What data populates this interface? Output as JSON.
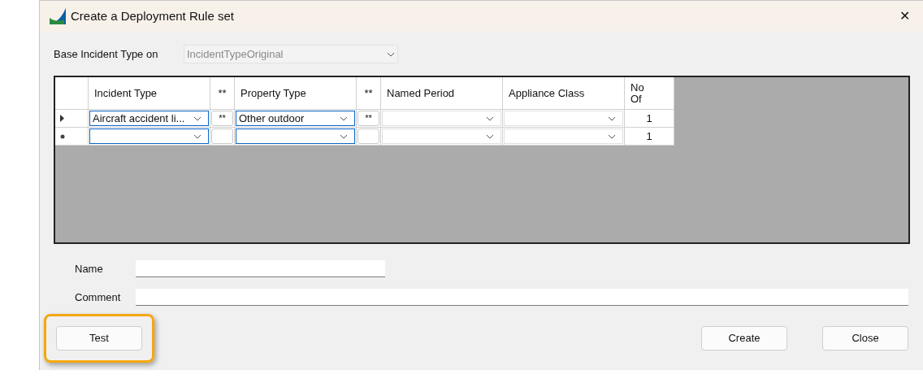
{
  "window": {
    "title": "Create a Deployment Rule set",
    "close_symbol": "✕"
  },
  "base_incident": {
    "label": "Base Incident Type on",
    "value": "IncidentTypeOriginal",
    "disabled": true
  },
  "grid": {
    "columns": [
      {
        "label": "Incident Type",
        "kind": "combo"
      },
      {
        "label": "**",
        "kind": "button"
      },
      {
        "label": "Property Type",
        "kind": "combo"
      },
      {
        "label": "**",
        "kind": "button"
      },
      {
        "label": "Named Period",
        "kind": "combo"
      },
      {
        "label": "Appliance Class",
        "kind": "combo"
      },
      {
        "label": "No Of",
        "kind": "number"
      }
    ],
    "rows": [
      {
        "kind": "current",
        "cells": [
          "Aircraft accident li...",
          "**",
          "Other outdoor",
          "**",
          null,
          null,
          null
        ],
        "number": "1"
      },
      {
        "kind": "new",
        "cells": [
          null,
          null,
          null,
          null,
          null,
          null,
          null
        ],
        "number": "1"
      }
    ]
  },
  "name_field": {
    "label": "Name"
  },
  "comment_field": {
    "label": "Comment"
  },
  "buttons": [
    {
      "label": "Test",
      "highlighted": true
    },
    {
      "label": "Create",
      "highlighted": false
    },
    {
      "label": "Close",
      "highlighted": false
    }
  ]
}
